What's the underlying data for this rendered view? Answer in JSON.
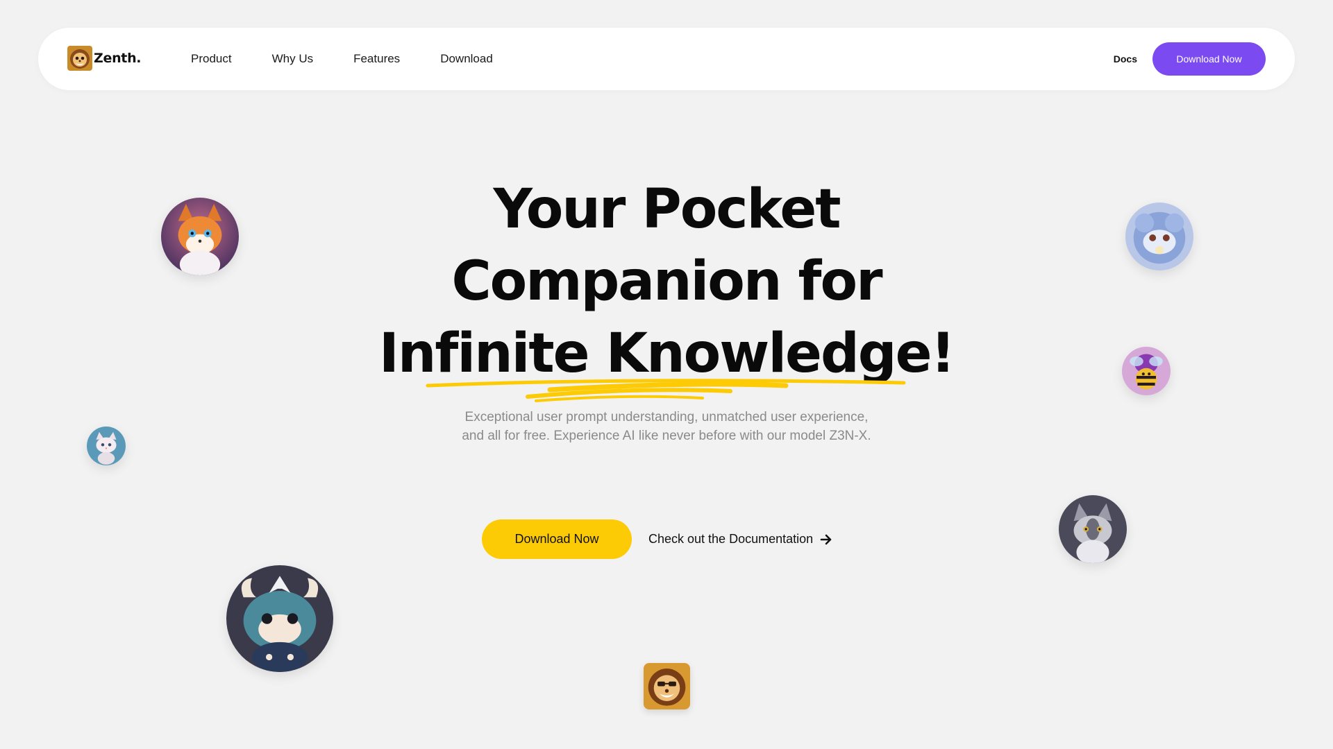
{
  "brand": {
    "name": "Zenth.",
    "logo_icon": "lion-mascot-icon"
  },
  "nav": {
    "links": [
      "Product",
      "Why Us",
      "Features",
      "Download"
    ],
    "docs_label": "Docs",
    "cta_label": "Download Now"
  },
  "hero": {
    "title_lines": [
      "Your Pocket",
      "Companion for",
      "Infinite Knowledge!"
    ],
    "subtitle": "Exceptional user prompt understanding, unmatched user experience, and all for free. Experience AI like never before with our model Z3N-X.",
    "primary_cta": "Download Now",
    "secondary_link": "Check out the Documentation",
    "secondary_icon": "arrow-right-icon"
  },
  "avatars": [
    "fox-avatar",
    "blue-fluffy-avatar",
    "purple-bee-avatar",
    "white-cat-avatar",
    "grey-cat-avatar",
    "blue-horned-monster-avatar",
    "lion-logo-avatar"
  ],
  "colors": {
    "background": "#f2f2f2",
    "nav_bg": "#ffffff",
    "nav_cta": "#7b4af0",
    "primary_cta": "#fccb06",
    "underline": "#fccb06",
    "subtitle": "#8a8a8a"
  }
}
